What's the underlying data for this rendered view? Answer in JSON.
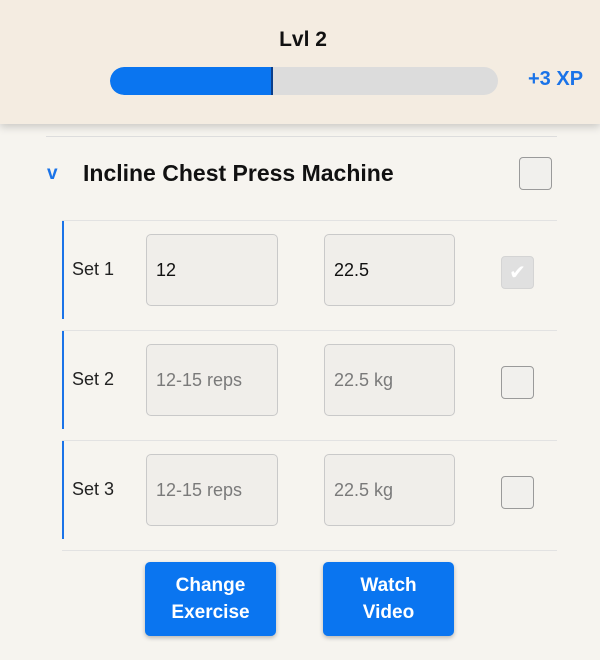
{
  "header": {
    "level_label": "Lvl 2",
    "xp_progress": 0.42,
    "xp_gain": "+3 XP"
  },
  "exercise": {
    "collapse_indicator": "v",
    "title": "Incline Chest Press Machine",
    "completed": false,
    "sets": [
      {
        "label": "Set 1",
        "reps_value": "12",
        "reps_placeholder": "12-15 reps",
        "weight_value": "22.5",
        "weight_placeholder": "22.5 kg",
        "done": true
      },
      {
        "label": "Set 2",
        "reps_value": "",
        "reps_placeholder": "12-15 reps",
        "weight_value": "",
        "weight_placeholder": "22.5 kg",
        "done": false
      },
      {
        "label": "Set 3",
        "reps_value": "",
        "reps_placeholder": "12-15 reps",
        "weight_value": "",
        "weight_placeholder": "22.5 kg",
        "done": false
      }
    ]
  },
  "actions": {
    "change_exercise": "Change Exercise",
    "watch_video": "Watch Video"
  },
  "icons": {
    "check": "check-icon"
  },
  "colors": {
    "accent": "#0a75f0",
    "header_bg": "#f4ece1",
    "page_bg": "#f6f4ef"
  }
}
